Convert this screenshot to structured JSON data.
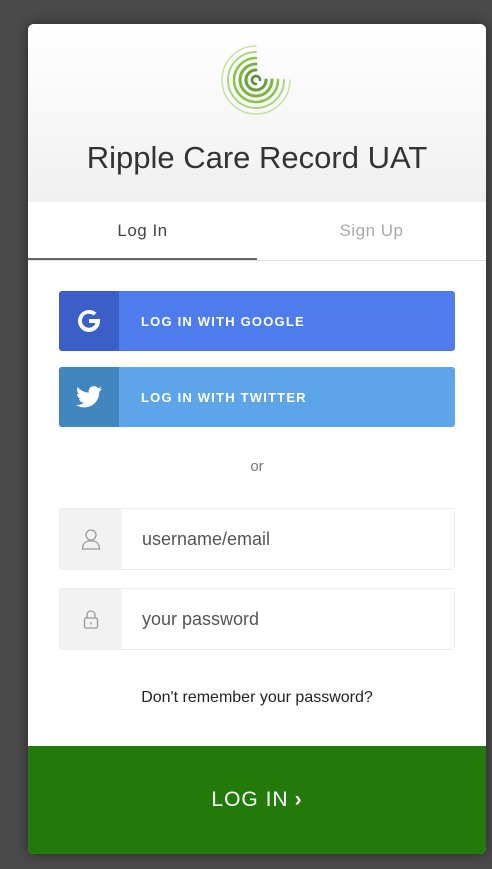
{
  "app": {
    "title": "Ripple Care Record UAT"
  },
  "tabs": [
    {
      "label": "Log In",
      "active": true
    },
    {
      "label": "Sign Up",
      "active": false
    }
  ],
  "social": {
    "google_label": "LOG IN WITH GOOGLE",
    "twitter_label": "LOG IN WITH TWITTER"
  },
  "separator": "or",
  "form": {
    "username_placeholder": "username/email",
    "username_value": "",
    "password_placeholder": "your password",
    "password_value": ""
  },
  "forgot_link": "Don't remember your password?",
  "submit": {
    "label": "LOG IN",
    "chevron": "›"
  },
  "colors": {
    "brand_green": "#237a0b",
    "google": "#4e7cec",
    "twitter": "#5da4e8",
    "logo_green": "#8bc34a"
  },
  "icons": {
    "logo": "ripple-logo-icon",
    "google": "google-icon",
    "twitter": "twitter-icon",
    "user": "user-icon",
    "lock": "lock-icon"
  }
}
